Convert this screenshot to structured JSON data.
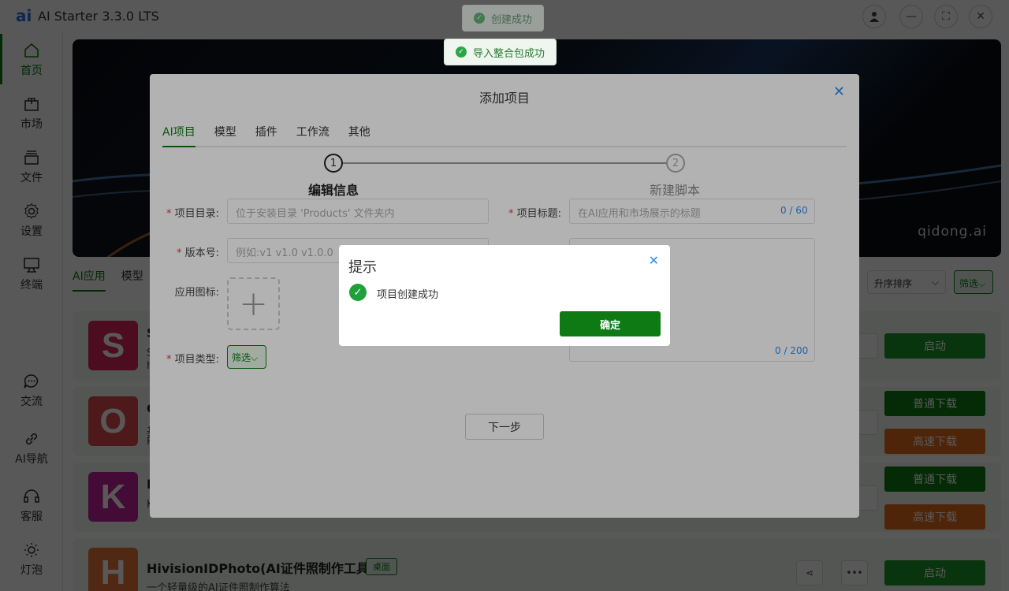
{
  "app": {
    "logo": "ai",
    "title": "AI Starter 3.3.0 LTS"
  },
  "window_controls": {
    "user": "user-icon",
    "minimize": "—",
    "maximize": "⛶",
    "close": "✕"
  },
  "sidebar": {
    "items": [
      {
        "label": "首页",
        "icon": "home-icon",
        "active": true
      },
      {
        "label": "市场",
        "icon": "market-icon"
      },
      {
        "label": "文件",
        "icon": "files-icon"
      },
      {
        "label": "设置",
        "icon": "gear-icon"
      },
      {
        "label": "终端",
        "icon": "terminal-icon"
      },
      {
        "label": "交流",
        "icon": "chat-icon"
      },
      {
        "label": "AI导航",
        "icon": "link-icon"
      },
      {
        "label": "客服",
        "icon": "headset-icon"
      },
      {
        "label": "灯泡",
        "icon": "bulb-icon"
      }
    ]
  },
  "banner": {
    "brand": "qidong.ai"
  },
  "list_tabs": [
    "AI应用",
    "模型"
  ],
  "sort": {
    "label": "升序排序"
  },
  "filter": {
    "label": "筛选"
  },
  "cards": [
    {
      "letter": "S",
      "name": "S",
      "desc_1": "S",
      "desc_2": "h",
      "color": "#d9265a",
      "buttons": [
        "启动"
      ]
    },
    {
      "letter": "O",
      "name": "C",
      "desc_1": "基",
      "desc_2": "P",
      "color": "#e0484c",
      "buttons": [
        "普通下载",
        "高速下载"
      ]
    },
    {
      "letter": "K",
      "name": "K",
      "desc_1": "K",
      "color": "#c2229c",
      "buttons": [
        "普通下载",
        "高速下载"
      ]
    },
    {
      "letter": "H",
      "name": "HivisionIDPhoto(AI证件照制作工具)",
      "tag": "桌面",
      "desc_1": "一个轻量级的AI证件照制作算法",
      "color": "#e8743a",
      "buttons": [
        "启动"
      ]
    }
  ],
  "toasts": [
    {
      "text": "创建成功"
    },
    {
      "text": "导入整合包成功"
    }
  ],
  "dialog": {
    "title": "添加项目",
    "tabs": [
      "AI项目",
      "模型",
      "插件",
      "工作流",
      "其他"
    ],
    "steps": [
      {
        "num": "1",
        "label": "编辑信息"
      },
      {
        "num": "2",
        "label": "新建脚本"
      }
    ],
    "fields": {
      "dir_label": "项目目录:",
      "dir_placeholder": "位于安装目录 'Products' 文件夹内",
      "title_label": "项目标题:",
      "title_placeholder": "在AI应用和市场展示的标题",
      "title_counter": "0 / 60",
      "version_label": "版本号:",
      "version_placeholder": "例如:v1 v1.0 v1.0.0",
      "icon_label": "应用图标:",
      "type_label": "项目类型:",
      "type_button": "筛选",
      "desc_counter": "0 / 200"
    },
    "next_button": "下一步",
    "required_mark": "*"
  },
  "message_box": {
    "title": "提示",
    "text": "项目创建成功",
    "ok_button": "确定"
  }
}
